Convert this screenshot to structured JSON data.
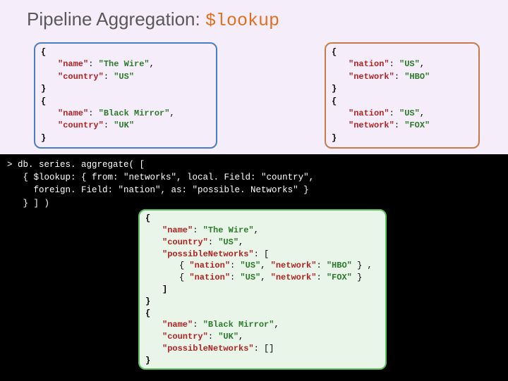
{
  "title": {
    "prefix": "Pipeline Aggregation: ",
    "keyword": "$lookup"
  },
  "series": [
    {
      "name": "\"name\"",
      "name_val": "\"The Wire\"",
      "country": "\"country\"",
      "country_val": "\"US\""
    },
    {
      "name": "\"name\"",
      "name_val": "\"Black Mirror\"",
      "country": "\"country\"",
      "country_val": "\"UK\""
    }
  ],
  "networks": [
    {
      "nation": "\"nation\"",
      "nation_val": "\"US\"",
      "network": "\"network\"",
      "network_val": "\"HBO\""
    },
    {
      "nation": "\"nation\"",
      "nation_val": "\"US\"",
      "network": "\"network\"",
      "network_val": "\"FOX\""
    }
  ],
  "shell": {
    "line1": "> db. series. aggregate( [",
    "line2": "   { $lookup: { from: \"networks\", local. Field: \"country\",",
    "line3": "     foreign. Field: \"nation\", as: \"possible. Networks\" }",
    "line4": "   } ] )"
  },
  "result": {
    "r1_name_k": "\"name\"",
    "r1_name_v": "\"The Wire\"",
    "r1_country_k": "\"country\"",
    "r1_country_v": "\"US\"",
    "r1_pn_k": "\"possibleNetworks\"",
    "r1_pn_row1_nation_k": "\"nation\"",
    "r1_pn_row1_nation_v": "\"US\"",
    "r1_pn_row1_net_k": "\"network\"",
    "r1_pn_row1_net_v": "\"HBO\"",
    "r1_pn_row2_nation_k": "\"nation\"",
    "r1_pn_row2_nation_v": "\"US\"",
    "r1_pn_row2_net_k": "\"network\"",
    "r1_pn_row2_net_v": "\"FOX\"",
    "r2_name_k": "\"name\"",
    "r2_name_v": "\"Black Mirror\"",
    "r2_country_k": "\"country\"",
    "r2_country_v": "\"UK\"",
    "r2_pn_k": "\"possibleNetworks\"",
    "r2_pn_v": "[]"
  },
  "syntax": {
    "open": "{",
    "close": "}",
    "open_arr": ": [",
    "close_arr": "]",
    "colon": ": ",
    "comma": ","
  }
}
